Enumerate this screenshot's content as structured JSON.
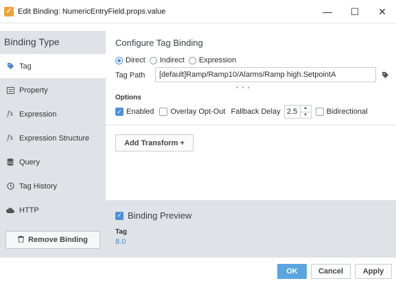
{
  "window": {
    "title": "Edit Binding: NumericEntryField.props.value",
    "minimize": "—",
    "maximize": "☐",
    "close": "✕"
  },
  "sidebar": {
    "heading": "Binding Type",
    "items": [
      {
        "label": "Tag",
        "icon": "tag-icon",
        "active": true
      },
      {
        "label": "Property",
        "icon": "property-icon"
      },
      {
        "label": "Expression",
        "icon": "fx-icon"
      },
      {
        "label": "Expression Structure",
        "icon": "fx-icon"
      },
      {
        "label": "Query",
        "icon": "database-icon"
      },
      {
        "label": "Tag History",
        "icon": "clock-icon"
      },
      {
        "label": "HTTP",
        "icon": "cloud-icon"
      }
    ],
    "remove_button": "Remove Binding"
  },
  "config": {
    "title": "Configure Tag Binding",
    "modes": [
      {
        "label": "Direct",
        "selected": true
      },
      {
        "label": "Indirect",
        "selected": false
      },
      {
        "label": "Expression",
        "selected": false
      }
    ],
    "tag_path_label": "Tag Path",
    "tag_path_value": "[default]Ramp/Ramp10/Alarms/Ramp high.SetpointA",
    "options_label": "Options",
    "enabled_label": "Enabled",
    "enabled_checked": true,
    "overlay_label": "Overlay Opt-Out",
    "overlay_checked": false,
    "fallback_label": "Fallback Delay",
    "fallback_value": "2.5",
    "bidirectional_label": "Bidirectional",
    "bidirectional_checked": false,
    "add_transform_label": "Add Transform +"
  },
  "preview": {
    "title": "Binding Preview",
    "checked": true,
    "label": "Tag",
    "value": "8.0"
  },
  "footer": {
    "ok": "OK",
    "cancel": "Cancel",
    "apply": "Apply"
  },
  "colors": {
    "accent": "#4a90d9",
    "sidebar_bg": "#dfe3e7",
    "app_icon": "#f0a33a"
  }
}
